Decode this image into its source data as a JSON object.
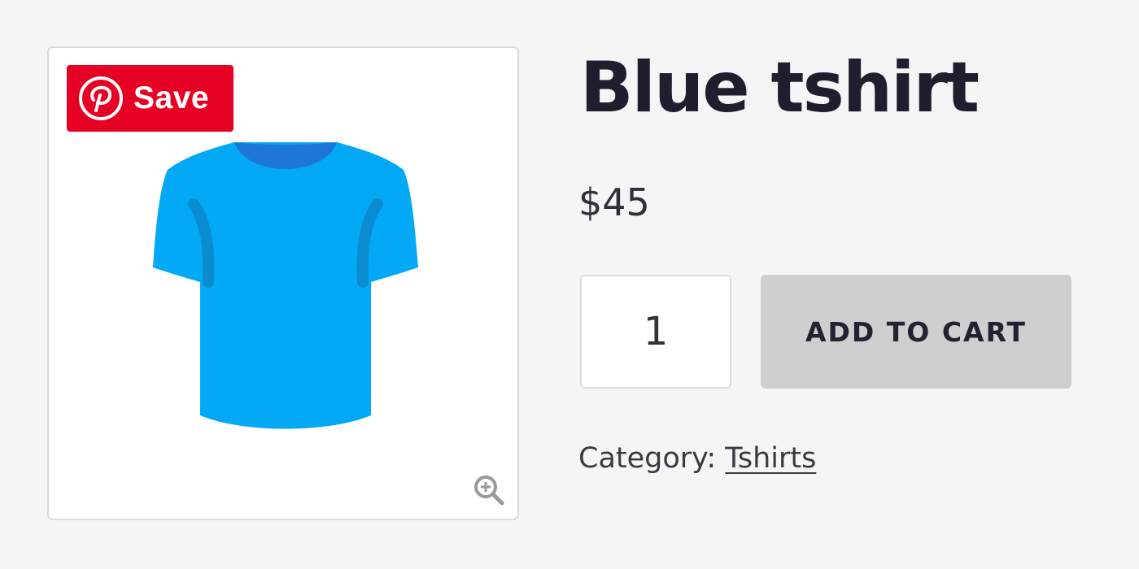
{
  "product": {
    "title": "Blue tshirt",
    "price": "$45",
    "image_icon": "tshirt-image",
    "shirt_color": "#03a9f4",
    "shirt_collar_color": "#1e76d6"
  },
  "pinterest": {
    "save_label": "Save",
    "icon": "pinterest-icon",
    "color": "#e60023"
  },
  "gallery": {
    "zoom_icon": "zoom-in-icon"
  },
  "cart": {
    "quantity": "1",
    "add_to_cart_label": "ADD TO CART"
  },
  "meta": {
    "category_label": "Category:",
    "category_value": "Tshirts"
  }
}
